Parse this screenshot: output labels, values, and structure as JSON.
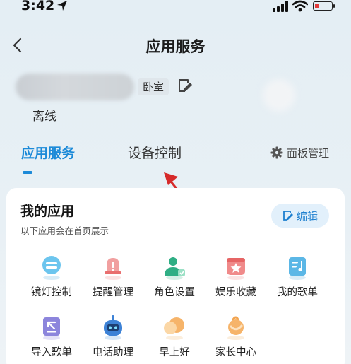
{
  "status_bar": {
    "time": "3:42"
  },
  "header": {
    "title": "应用服务"
  },
  "device": {
    "room": "卧室",
    "status": "离线"
  },
  "tabs": [
    {
      "label": "应用服务",
      "active": true
    },
    {
      "label": "设备控制",
      "active": false
    }
  ],
  "panel_management": {
    "label": "面板管理"
  },
  "my_apps": {
    "title": "我的应用",
    "subtitle": "以下应用会在首页展示",
    "edit_label": "编辑",
    "apps": [
      {
        "label": "镜灯控制",
        "icon": "mirror-light-icon"
      },
      {
        "label": "提醒管理",
        "icon": "bell-icon"
      },
      {
        "label": "角色设置",
        "icon": "role-icon"
      },
      {
        "label": "娱乐收藏",
        "icon": "star-icon"
      },
      {
        "label": "我的歌单",
        "icon": "playlist-icon"
      },
      {
        "label": "导入歌单",
        "icon": "import-playlist-icon"
      },
      {
        "label": "电话助理",
        "icon": "robot-icon"
      },
      {
        "label": "早上好",
        "icon": "morning-icon"
      },
      {
        "label": "家长中心",
        "icon": "parent-center-icon"
      }
    ]
  },
  "colors": {
    "accent": "#1c8ad8",
    "card_bg": "#ffffff",
    "page_bg": "#e6eff4"
  }
}
